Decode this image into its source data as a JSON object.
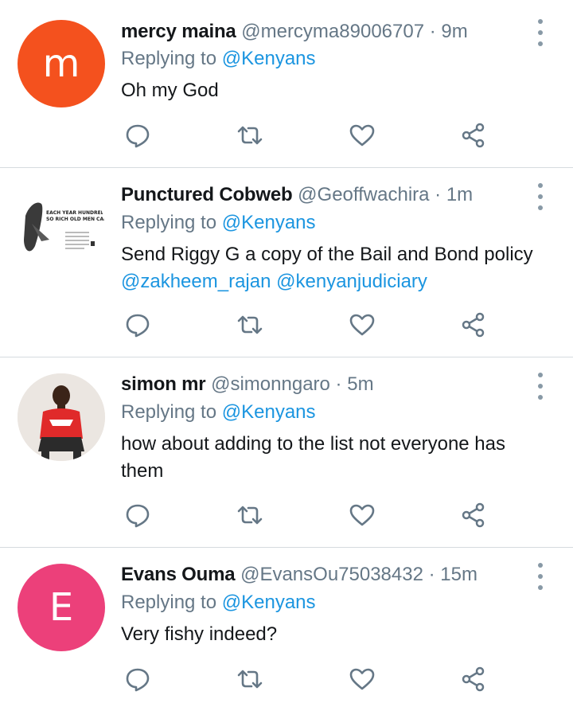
{
  "tweets": [
    {
      "avatar_letter": "m",
      "avatar_color": "#f4511e",
      "name": "mercy maina",
      "handle": "@mercyma89006707",
      "separator": "·",
      "time": "9m",
      "replying_prefix": "Replying to",
      "replying_to": "@Kenyans",
      "text": "Oh my God",
      "mentions": ""
    },
    {
      "avatar_letter": "",
      "avatar_color": "#ffffff",
      "avatar_image_text": "EACH YEAR HUNDREDS DURN SO RICH OLD MEN CAN GET THE",
      "name": "Punctured Cobweb",
      "handle": "@Geoffwachira",
      "separator": "·",
      "time": "1m",
      "replying_prefix": "Replying to",
      "replying_to": "@Kenyans",
      "text": "Send Riggy G a copy of the Bail and Bond policy",
      "mentions": "@zakheem_rajan @kenyanjudiciary"
    },
    {
      "avatar_letter": "",
      "avatar_color": "#e8e2dc",
      "name": "simon mr",
      "handle": "@simonngaro",
      "separator": "·",
      "time": "5m",
      "replying_prefix": "Replying to",
      "replying_to": "@Kenyans",
      "text": "how about adding to the list not everyone has them",
      "mentions": ""
    },
    {
      "avatar_letter": "E",
      "avatar_color": "#ec407a",
      "name": "Evans Ouma",
      "handle": "@EvansOu75038432",
      "separator": "·",
      "time": "15m",
      "replying_prefix": "Replying to",
      "replying_to": "@Kenyans",
      "text": "Very fishy indeed?",
      "mentions": ""
    }
  ],
  "colors": {
    "link": "#1b95e0",
    "secondary_text": "#657786",
    "icon": "#657786",
    "divider": "#d6dbdf"
  },
  "icons": [
    "reply-icon",
    "retweet-icon",
    "like-icon",
    "share-icon",
    "more-options-icon"
  ]
}
